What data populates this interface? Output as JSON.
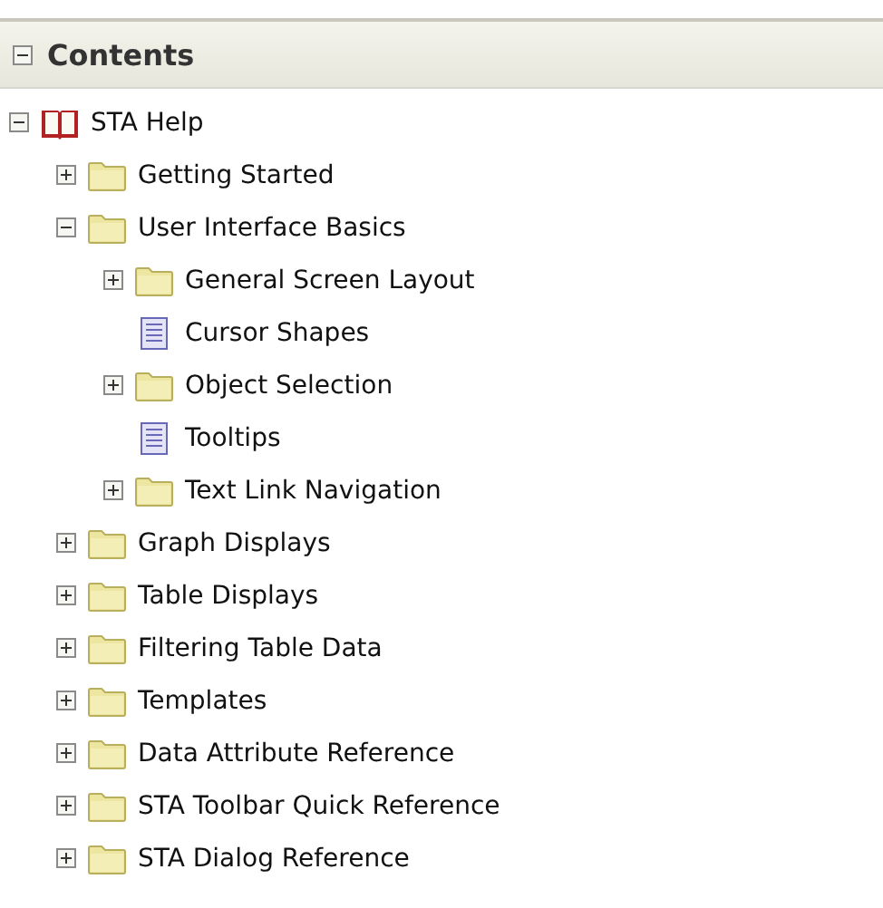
{
  "panel": {
    "title": "Contents",
    "expanded": true
  },
  "tree": [
    {
      "kind": "book",
      "label": "STA Help",
      "expanded": true,
      "children": [
        {
          "kind": "folder",
          "label": "Getting Started",
          "expanded": false
        },
        {
          "kind": "folder",
          "label": "User Interface Basics",
          "expanded": true,
          "children": [
            {
              "kind": "folder",
              "label": "General Screen Layout",
              "expanded": false
            },
            {
              "kind": "page",
              "label": "Cursor Shapes"
            },
            {
              "kind": "folder",
              "label": "Object Selection",
              "expanded": false
            },
            {
              "kind": "page",
              "label": "Tooltips"
            },
            {
              "kind": "folder",
              "label": "Text Link Navigation",
              "expanded": false
            }
          ]
        },
        {
          "kind": "folder",
          "label": "Graph Displays",
          "expanded": false
        },
        {
          "kind": "folder",
          "label": "Table Displays",
          "expanded": false
        },
        {
          "kind": "folder",
          "label": "Filtering Table Data",
          "expanded": false
        },
        {
          "kind": "folder",
          "label": "Templates",
          "expanded": false
        },
        {
          "kind": "folder",
          "label": "Data Attribute Reference",
          "expanded": false
        },
        {
          "kind": "folder",
          "label": "STA Toolbar Quick Reference",
          "expanded": false
        },
        {
          "kind": "folder",
          "label": "STA Dialog Reference",
          "expanded": false
        }
      ]
    }
  ]
}
